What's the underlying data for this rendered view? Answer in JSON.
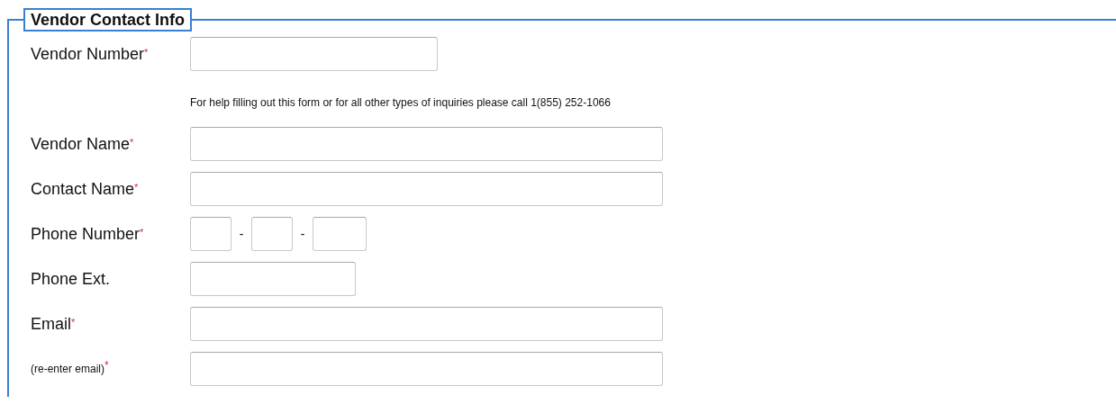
{
  "legend": "Vendor Contact Info",
  "fields": [
    {
      "kind": "medium",
      "label": "Vendor Number",
      "required_mark": "*"
    },
    {
      "kind": "help",
      "text": "For help filling out this form or for all other types of inquiries please call 1(855) 252-1066"
    },
    {
      "kind": "wide",
      "label": "Vendor Name",
      "required_mark": "*"
    },
    {
      "kind": "wide",
      "label": "Contact Name",
      "required_mark": "*"
    },
    {
      "kind": "phone",
      "label": "Phone Number",
      "required_mark": "*",
      "separators": [
        "-",
        "-"
      ]
    },
    {
      "kind": "short",
      "label": "Phone Ext."
    },
    {
      "kind": "wide",
      "label": "Email",
      "required_mark": "*"
    },
    {
      "kind": "confirm",
      "label": "(re-enter email)",
      "required_mark": "*"
    }
  ]
}
